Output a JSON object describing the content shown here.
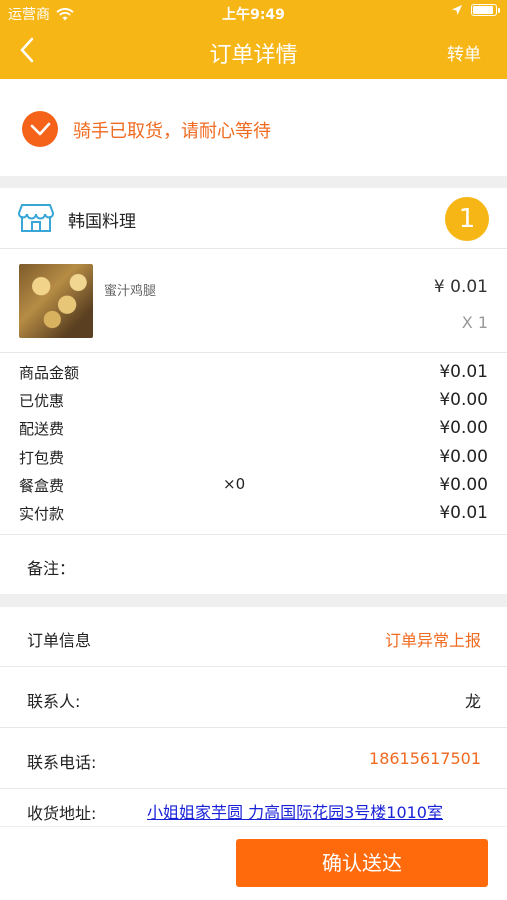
{
  "statusbar": {
    "carrier": "运营商",
    "time": "上午9:49"
  },
  "navbar": {
    "title": "订单详情",
    "right_action": "转单"
  },
  "order_status": {
    "text": "骑手已取货，请耐心等待"
  },
  "shop": {
    "name": "韩国料理",
    "number": "1"
  },
  "item": {
    "name": "蜜汁鸡腿",
    "price": "¥ 0.01",
    "quantity": "X 1"
  },
  "fees": [
    {
      "label": "商品金额",
      "mid": "",
      "value": "¥0.01"
    },
    {
      "label": "已优惠",
      "mid": "",
      "value": "¥0.00"
    },
    {
      "label": "配送费",
      "mid": "",
      "value": "¥0.00"
    },
    {
      "label": "打包费",
      "mid": "",
      "value": "¥0.00"
    },
    {
      "label": "餐盒费",
      "mid": "×0",
      "value": "¥0.00"
    },
    {
      "label": "实付款",
      "mid": "",
      "value": "¥0.01"
    }
  ],
  "remark": {
    "label": "备注："
  },
  "order_info": {
    "label": "订单信息",
    "action": "订单异常上报"
  },
  "contact": {
    "label": "联系人:",
    "value": "龙"
  },
  "phone": {
    "label": "联系电话:",
    "value": "18615617501"
  },
  "address": {
    "label": "收货地址:",
    "value": "小姐姐家芋圆 力高国际花园3号楼1010室"
  },
  "bottom": {
    "confirm_label": "确认送达"
  },
  "colors": {
    "header": "#f6b616",
    "accent_orange": "#f06a20",
    "button": "#ff6a0c",
    "link": "#1a22d8"
  }
}
